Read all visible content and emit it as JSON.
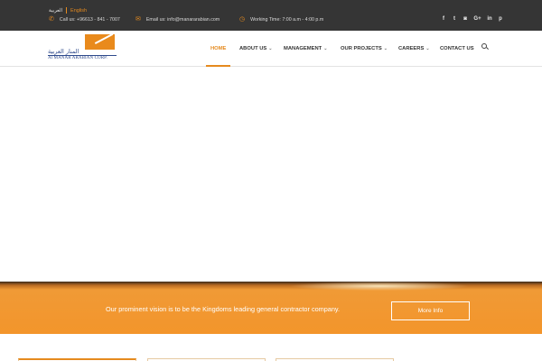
{
  "topbar": {
    "lang_arabic": "العربية",
    "lang_english": "English",
    "phone": "Call us: +96613 - 841 - 7007",
    "email": "Email us: info@manararabian.com",
    "hours": "Working Time: 7:00 a.m - 4:00 p.m",
    "social_icons": [
      "facebook-icon",
      "twitter-icon",
      "instagram-icon",
      "google-plus-icon",
      "linkedin-icon",
      "pinterest-icon"
    ],
    "social_glyphs": [
      "f",
      "t",
      "◙",
      "G+",
      "in",
      "p"
    ]
  },
  "logo": {
    "arabic": "المنار العربية",
    "english": "Al MANAR ARABIAN CORP."
  },
  "nav": {
    "items": [
      {
        "label": "HOME",
        "active": true,
        "dropdown": false
      },
      {
        "label": "ABOUT US",
        "active": false,
        "dropdown": true
      },
      {
        "label": "MANAGEMENT",
        "active": false,
        "dropdown": true
      },
      {
        "label": "OUR PROJECTS",
        "active": false,
        "dropdown": true
      },
      {
        "label": "CAREERS",
        "active": false,
        "dropdown": true
      },
      {
        "label": "CONTACT US",
        "active": false,
        "dropdown": false
      }
    ]
  },
  "banner": {
    "text": "Our prominent vision is to be the Kingdoms leading general contractor company.",
    "button": "More Info"
  },
  "colors": {
    "accent": "#e58a1e",
    "topbar_bg": "#353535",
    "banner": "#f3952b"
  }
}
